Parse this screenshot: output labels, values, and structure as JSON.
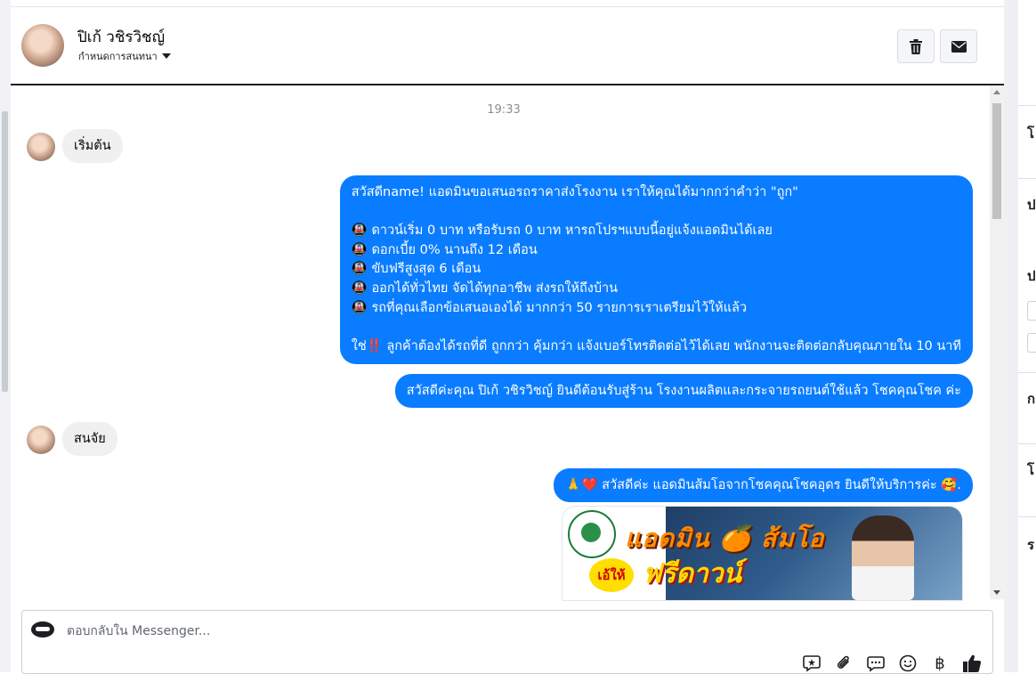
{
  "header": {
    "name": "ปิเก้ วชิรวิชญ์",
    "subtitle": "กำหนดการสนทนา",
    "delete_icon": "trash-icon",
    "mail_icon": "envelope-icon"
  },
  "conversation": {
    "timestamp": "19:33",
    "incoming_1": "เริ่มต้น",
    "outgoing_1_lines": [
      "สวัสดีname! แอดมินขอเสนอรถราคาส่งโรงงาน เราให้คุณได้มากกว่าคำว่า \"ถูก\"",
      "",
      "🚇 ดาวน์เริ่ม 0 บาท หรือรับรถ 0 บาท หารถโปรฯแบบนี้อยู่แจ้งแอดมินได้เลย",
      "🚇 ดอกเบี้ย 0% นานถึง 12 เดือน",
      "🚇 ขับฟรีสูงสุด 6 เดือน",
      "🚇 ออกได้ทั่วไทย จัดได้ทุกอาชีพ ส่งรถให้ถึงบ้าน",
      "🚇 รถที่คุณเลือกข้อเสนอเองได้ มากกว่า 50 รายการเราเตรียมไว้ให้แล้ว",
      "",
      "ใช่‼️ ลูกค้าต้องได้รถที่ดี ถูกกว่า คุ้มกว่า แจ้งเบอร์โทรติดต่อไว้ได้เลย พนักงานจะติดต่อกลับคุณภายใน 10 นาที"
    ],
    "outgoing_2": "สวัสดีค่ะคุณ ปิเก้ วชิรวิชญ์ ยินดีต้อนรับสู่ร้าน โรงงานผลิตและกระจายรถยนต์ใช้แล้ว โชคคุณโชค ค่ะ",
    "incoming_2": "สนจัย",
    "outgoing_3": "🙏❤️ สวัสดีค่ะ แอดมินส้มโอจากโชคคุณโชคอุดร ยินดีให้บริการค่ะ 🥰.",
    "image": {
      "title_1": "แอดมิน 🍊 ส้มโอ",
      "title_2": "ฟรีดาวน์",
      "burst": "เอ้ให้"
    }
  },
  "composer": {
    "placeholder": "ตอบกลับใน Messenger...",
    "tools": [
      "sticker-icon",
      "attachment-icon",
      "saved-reply-icon",
      "emoji-icon",
      "baht-payment-icon",
      "like-icon"
    ],
    "baht_symbol": "฿"
  },
  "right_panel": {
    "letters": [
      "โ",
      "ป",
      "ป",
      "ก",
      "โ",
      "ร"
    ]
  },
  "colors": {
    "outgoing_bubble": "#0a7cff",
    "incoming_bubble": "#f0f0f0"
  }
}
